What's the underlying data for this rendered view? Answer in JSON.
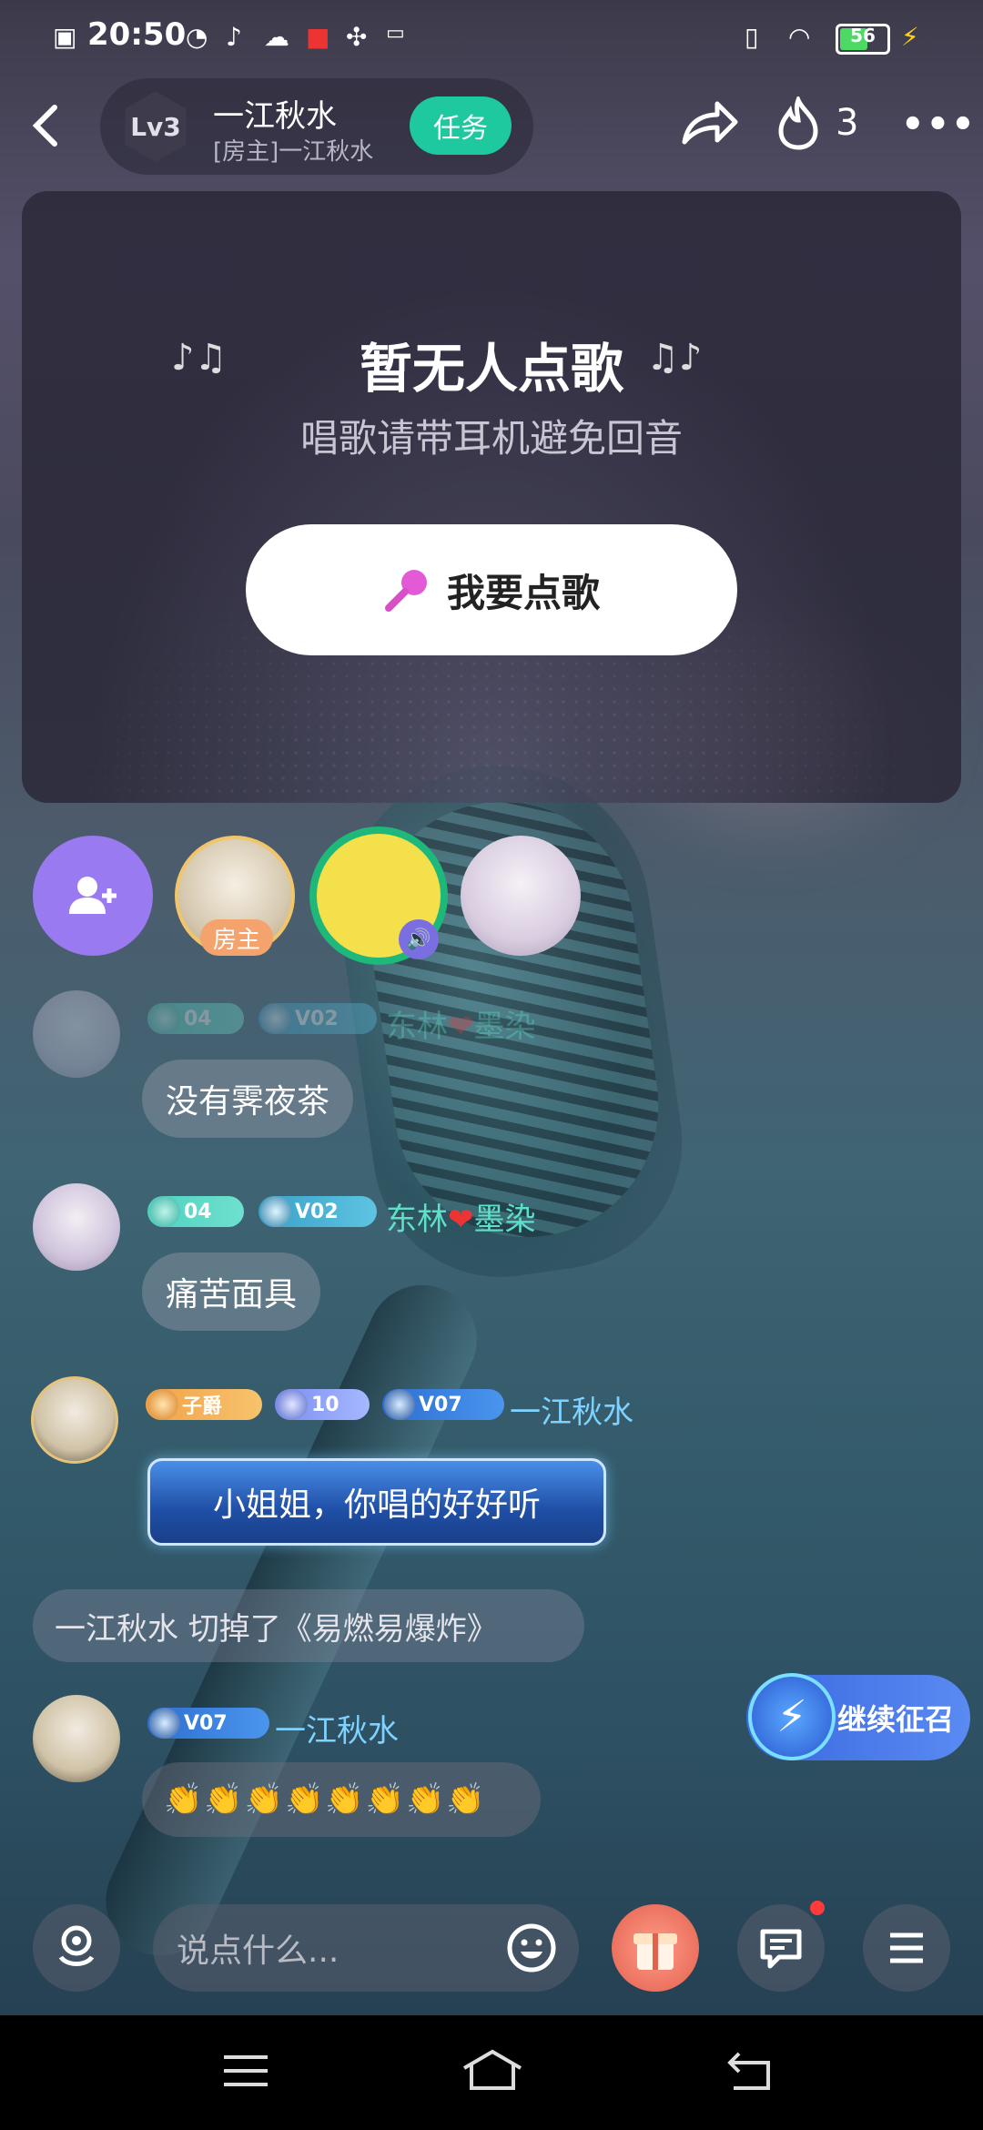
{
  "status": {
    "time": "20:50",
    "battery": "56"
  },
  "header": {
    "level": "Lv3",
    "room_name": "一江秋水",
    "room_sub": "[房主]一江秋水",
    "task_label": "任务",
    "heat_count": "3"
  },
  "panel": {
    "title": "暂无人点歌",
    "hint": "唱歌请带耳机避免回音",
    "request_label": "我要点歌"
  },
  "seats": {
    "host_tag": "房主"
  },
  "messages": [
    {
      "badges": [
        "04",
        "V02"
      ],
      "user": "东林",
      "user2": "墨染",
      "text": "没有霁夜茶"
    },
    {
      "badges": [
        "04",
        "V02"
      ],
      "user": "东林",
      "user2": "墨染",
      "text": "痛苦面具"
    },
    {
      "badges": [
        "子爵",
        "10",
        "V07"
      ],
      "user": "一江秋水",
      "text": "小姐姐，你唱的好好听"
    },
    {
      "badges": [
        "V07"
      ],
      "user": "一江秋水",
      "text": "👏👏👏👏👏👏👏👏"
    }
  ],
  "system_msg": "一江秋水 切掉了《易燃易爆炸》",
  "recall_label": "继续征召",
  "input": {
    "placeholder": "说点什么..."
  }
}
